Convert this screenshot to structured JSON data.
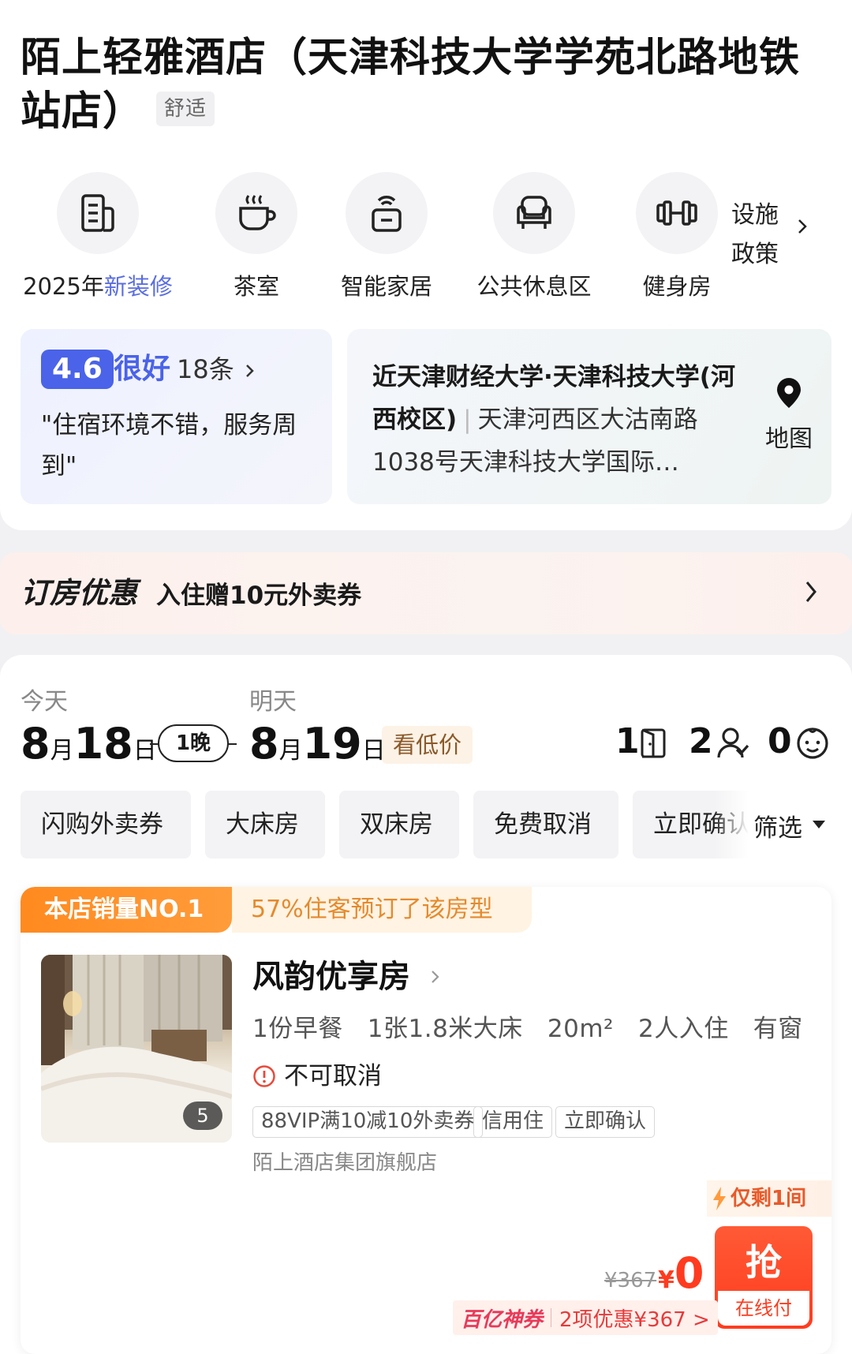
{
  "hotel": {
    "title": "陌上轻雅酒店（天津科技大学学苑北路地铁站店）",
    "level_tag": "舒适"
  },
  "facilities": [
    {
      "prefix": "2025年",
      "highlight": "新装修",
      "icon": "document-icon"
    },
    {
      "label": "茶室",
      "icon": "tea-cup-icon"
    },
    {
      "label": "智能家居",
      "icon": "smart-lock-icon"
    },
    {
      "label": "公共休息区",
      "icon": "armchair-icon"
    },
    {
      "label": "健身房",
      "icon": "dumbbell-icon"
    }
  ],
  "facility_more": {
    "line1": "设施",
    "line2": "政策"
  },
  "review": {
    "score": "4.6",
    "rating_word": "很好",
    "count": "18条",
    "quote": "\"住宿环境不错，服务周到\""
  },
  "location": {
    "landmark": "近天津财经大学·天津科技大学(河西校区)",
    "address": "天津河西区大沽南路1038号天津科技大学国际…",
    "map_label": "地图"
  },
  "promo": {
    "title": "订房优惠",
    "text": "入住赠10元外卖券"
  },
  "booking": {
    "checkin_label": "今天",
    "checkin_month": "8",
    "checkin_day": "18",
    "checkout_label": "明天",
    "checkout_month": "8",
    "checkout_day": "19",
    "month_unit": "月",
    "day_unit": "日",
    "nights": "1晚",
    "low_price": "看低价",
    "rooms": "1",
    "adults": "2",
    "children": "0"
  },
  "filters": [
    "闪购外卖券",
    "大床房",
    "双床房",
    "免费取消",
    "立即确认"
  ],
  "filter_label": "筛选",
  "room": {
    "rank_badge": "本店销量NO.1",
    "rank_note": "57%住客预订了该房型",
    "name": "风韵优享房",
    "photo_count": "5",
    "specs": "1份早餐   1张1.8米大床   20m²   2人入住   有窗",
    "cancel_policy": "不可取消",
    "tags": [
      "88VIP满10减10外卖券",
      "信用住",
      "立即确认"
    ],
    "store": "陌上酒店集团旗舰店",
    "stock_note": "仅剩1间",
    "original_price": "¥367",
    "currency": "¥",
    "price": "0",
    "button_label": "抢",
    "button_sub": "在线付",
    "coupon_brand": "百亿神券",
    "coupon_text": "2项优惠¥367 >"
  }
}
